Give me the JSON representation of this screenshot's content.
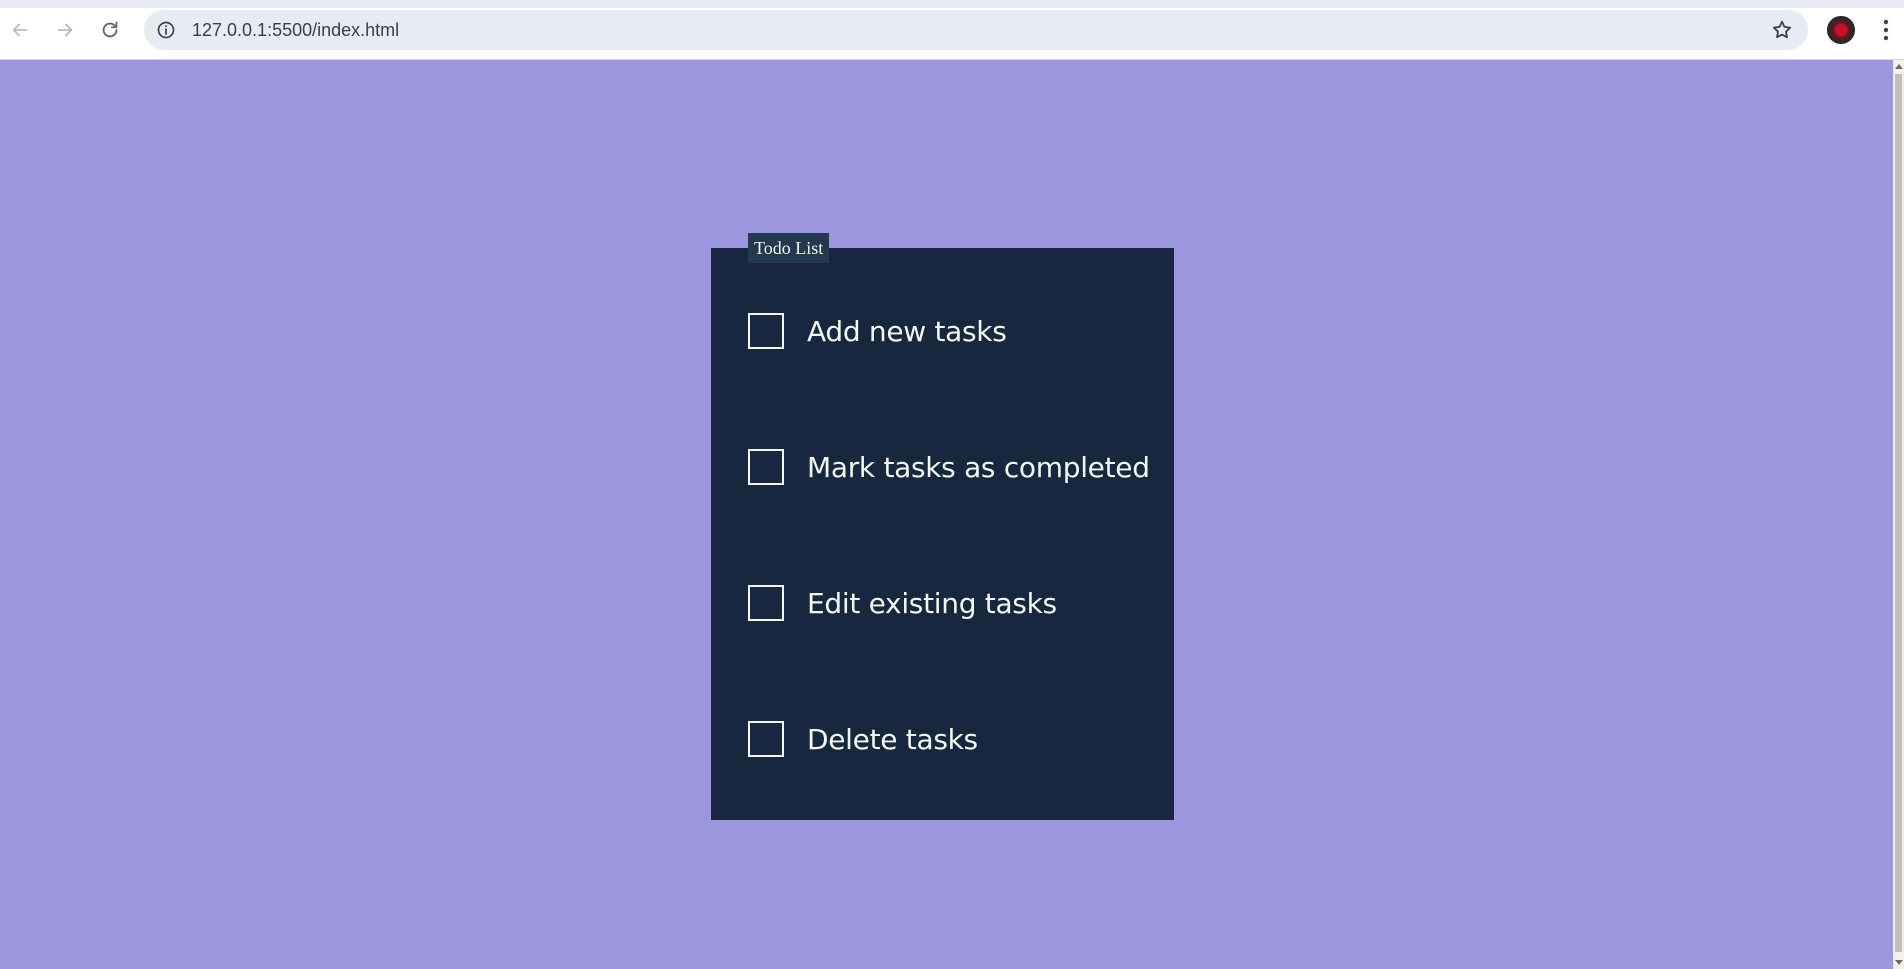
{
  "browser": {
    "url": "127.0.0.1:5500/index.html",
    "icons": {
      "back": "back-arrow-icon",
      "forward": "forward-arrow-icon",
      "reload": "reload-icon",
      "site_info": "info-icon",
      "bookmark": "star-icon",
      "menu": "kebab-menu-icon"
    }
  },
  "page": {
    "background_color": "#9c96df",
    "card_color": "#172740",
    "legend": "Todo List",
    "tasks": [
      {
        "label": "Add new tasks",
        "checked": false
      },
      {
        "label": "Mark tasks as completed",
        "checked": false
      },
      {
        "label": "Edit existing tasks",
        "checked": false
      },
      {
        "label": "Delete tasks",
        "checked": false
      }
    ]
  }
}
